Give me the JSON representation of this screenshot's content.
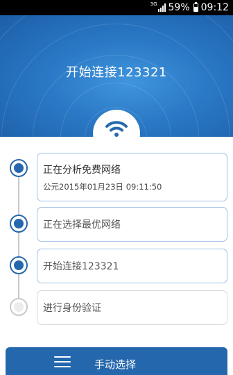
{
  "status_bar": {
    "network": "3G",
    "battery": "59%",
    "battery_level": 0.59,
    "time": "09:12"
  },
  "header": {
    "title": "开始连接123321",
    "icon": "wifi-icon"
  },
  "steps": [
    {
      "title": "正在分析免费网络",
      "timestamp": "公元2015年01月23日 09:11:50",
      "state": "done"
    },
    {
      "title": "正在选择最优网络",
      "state": "done"
    },
    {
      "title": "开始连接123321",
      "state": "done"
    },
    {
      "title": "进行身份验证",
      "state": "pending"
    }
  ],
  "bottom_button": {
    "label": "手动选择",
    "icon": "menu-icon"
  },
  "colors": {
    "accent": "#2467ad",
    "header_blue": "#2a78c5",
    "pending_gray": "#c9c9c9"
  }
}
